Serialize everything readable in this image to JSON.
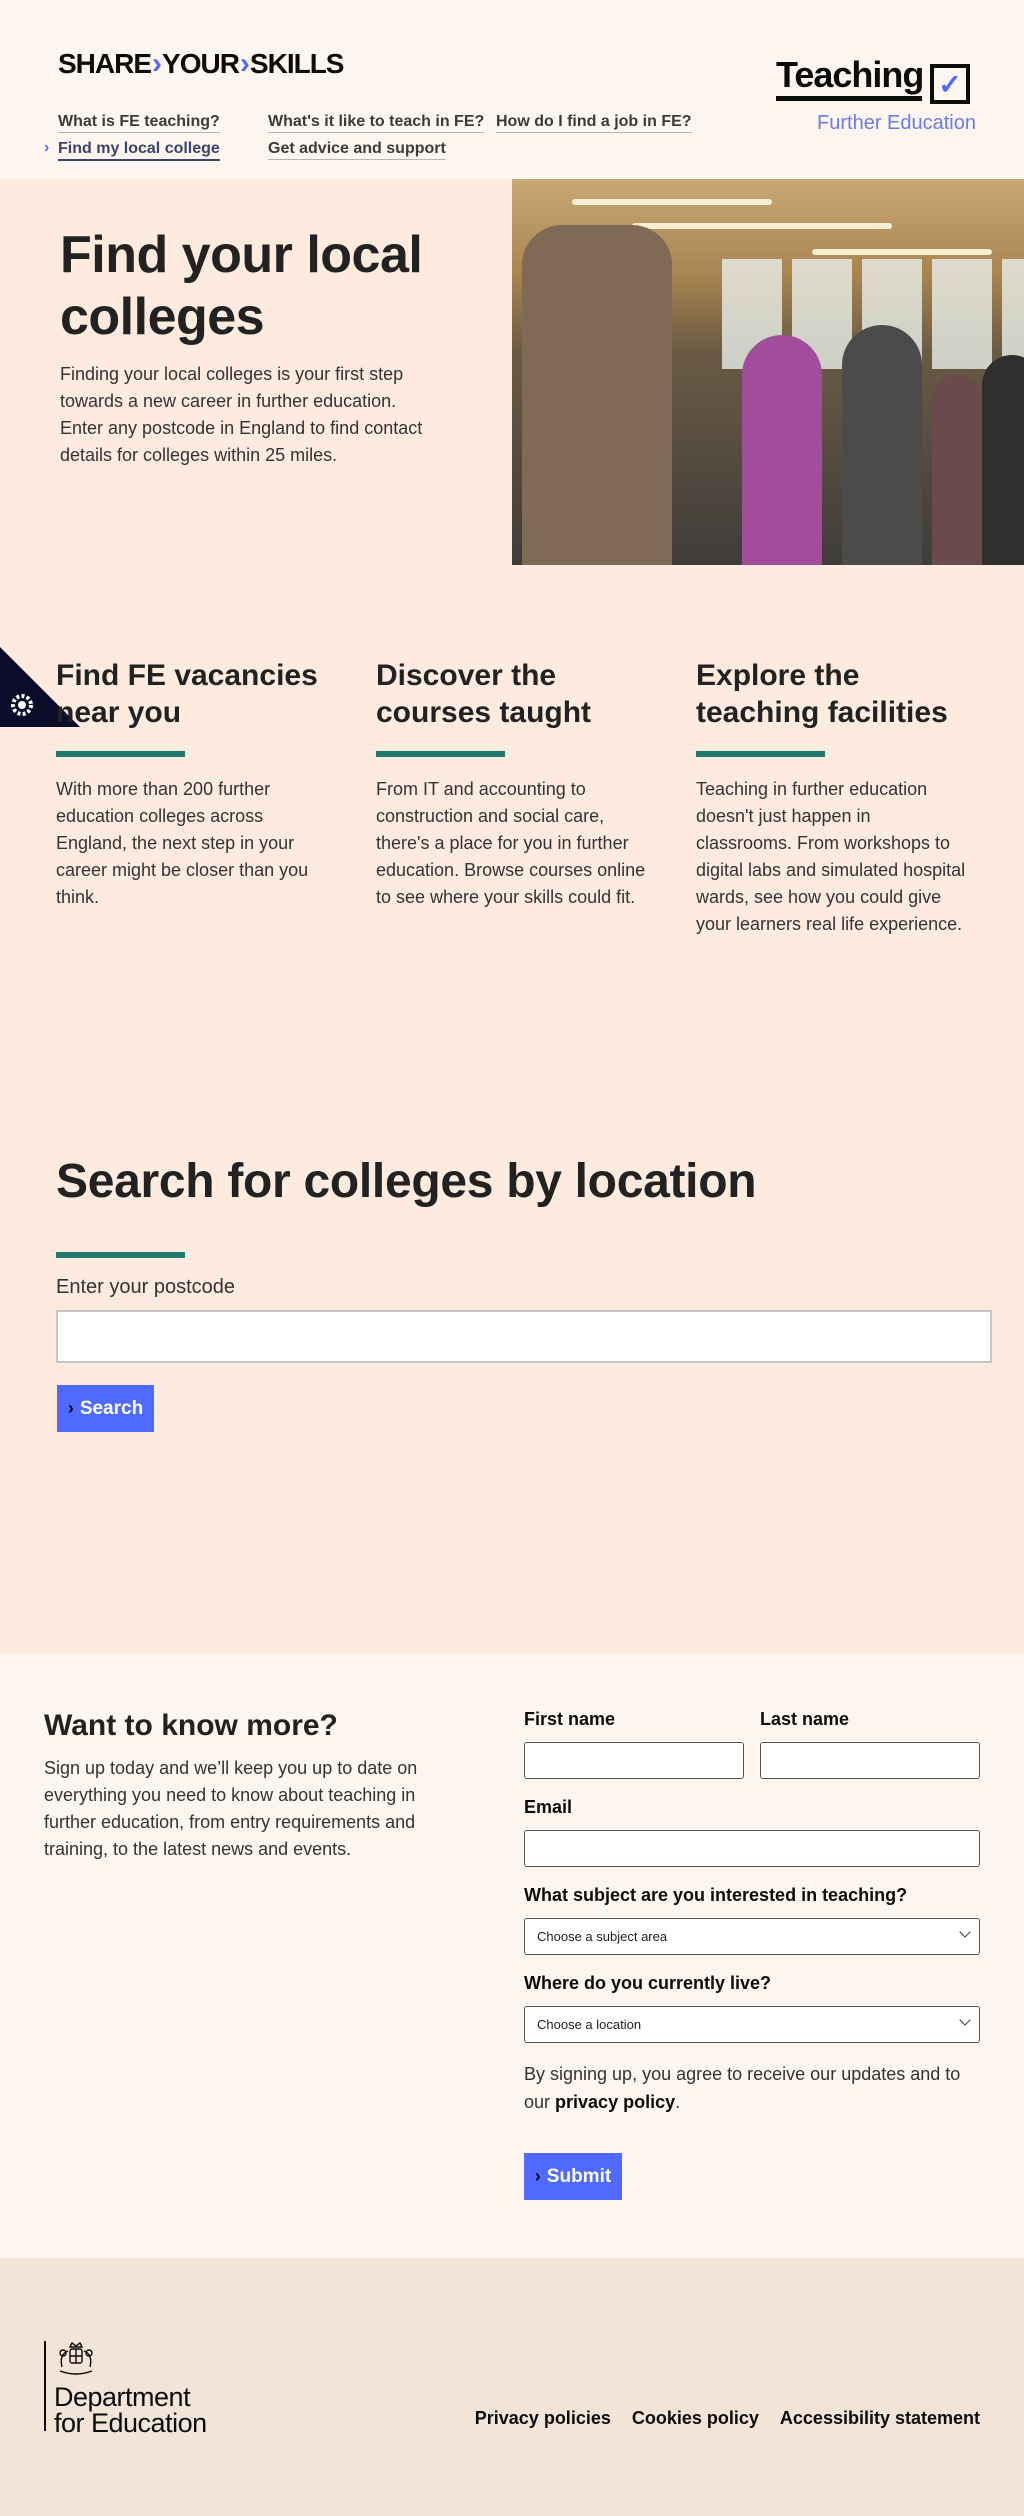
{
  "header": {
    "brand": {
      "word1": "SHARE",
      "word2": "YOUR",
      "word3": "SKILLS",
      "separator": "›"
    },
    "nav": [
      {
        "label": "What is FE teaching?"
      },
      {
        "label": "What's it like to teach in FE?"
      },
      {
        "label": "How do I find a job in FE?"
      },
      {
        "label": "Find my local college",
        "active": true
      },
      {
        "label": "Get advice and support"
      }
    ],
    "logo": {
      "word": "Teaching",
      "tick": "✓",
      "subtitle": "Further Education"
    }
  },
  "hero": {
    "title": "Find your local colleges",
    "body": "Finding your local colleges is your first step towards a new career in further education. Enter any postcode in England to find contact details for colleges within 25 miles."
  },
  "features": [
    {
      "title": "Find FE vacancies near you",
      "body": "With more than 200 further education colleges across England, the next step in your career might be closer than you think."
    },
    {
      "title": "Discover the courses taught",
      "body": "From IT and accounting to construction and social care, there's a place for you in further education. Browse courses online to see where your skills could fit."
    },
    {
      "title": "Explore the teaching facilities",
      "body": "Teaching in further education doesn't just happen in classrooms. From workshops to digital labs and simulated hospital wards, see how you could give your learners real life experience."
    }
  ],
  "search": {
    "title": "Search for colleges by location",
    "label": "Enter your postcode",
    "value": "",
    "button": "Search"
  },
  "signup": {
    "title": "Want to know more?",
    "lead": "Sign up today and we’ll keep you up to date on everything you need to know about teaching in further education, from entry requirements and training, to the latest news and events.",
    "first_name_label": "First name",
    "last_name_label": "Last name",
    "email_label": "Email",
    "subject_label": "What subject are you interested in teaching?",
    "subject_value": "Choose a subject area",
    "location_label": "Where do you currently live?",
    "location_value": "Choose a location",
    "consent_text": "By signing up, you agree to receive our updates and to our ",
    "consent_link": "privacy policy",
    "consent_end": ".",
    "submit": "Submit"
  },
  "footer": {
    "dept_line1": "Department",
    "dept_line2": "for Education",
    "links": [
      "Privacy policies",
      "Cookies policy",
      "Accessibility statement"
    ]
  },
  "colors": {
    "accent": "#4f6bff",
    "teal": "#1f7a6c",
    "peach": "#feebe0",
    "cream": "#fdf5f0",
    "footer": "#f3e4d8"
  }
}
